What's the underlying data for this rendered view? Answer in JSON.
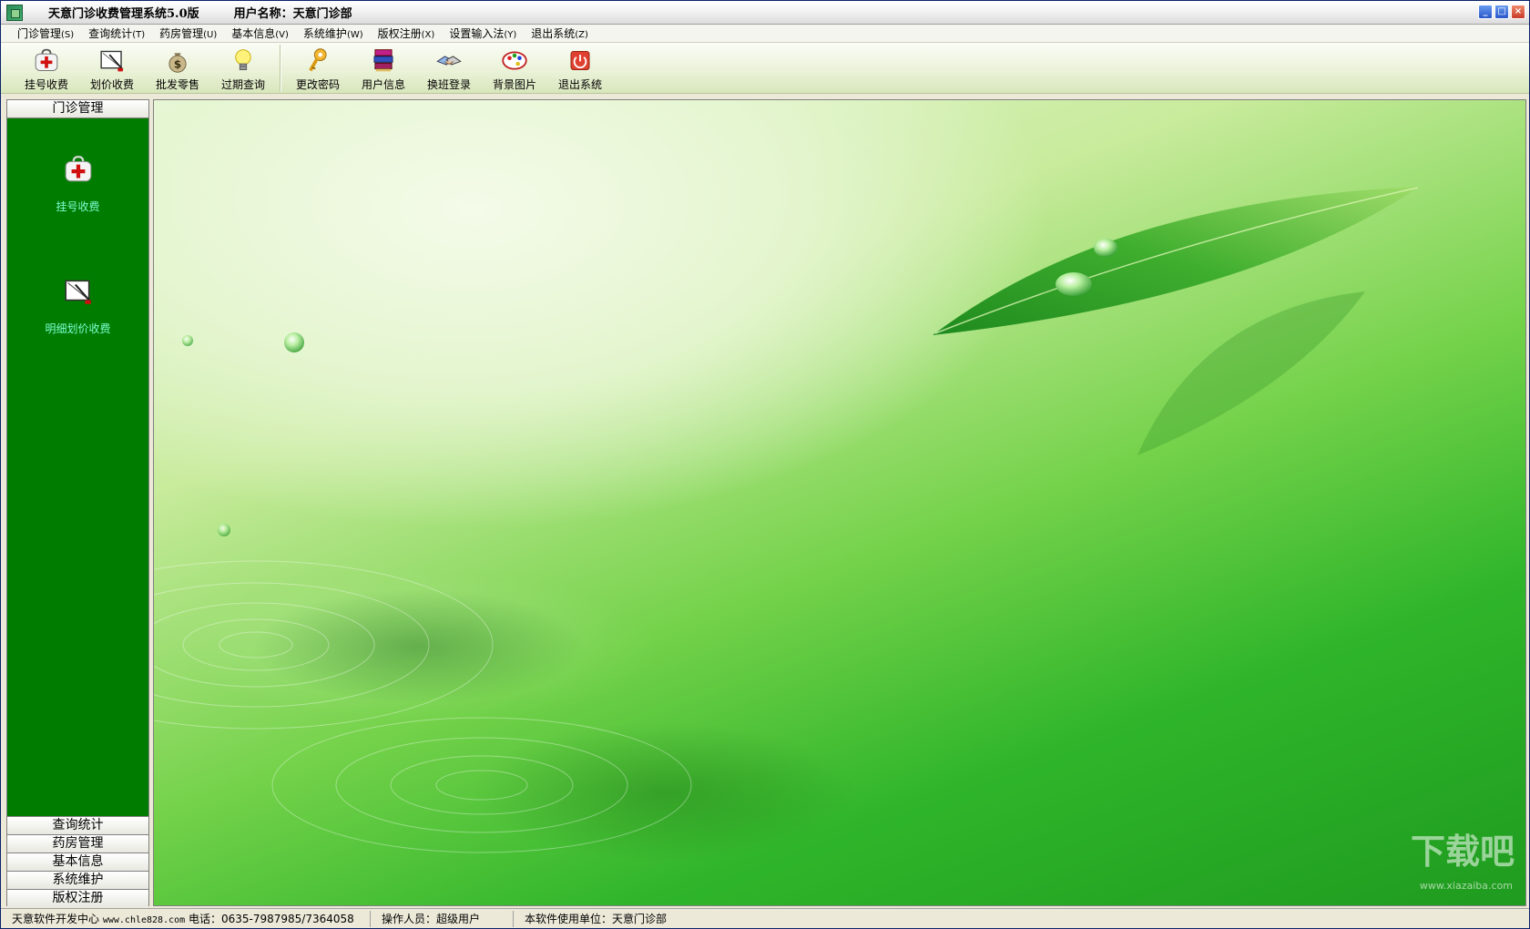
{
  "window": {
    "title": "天意门诊收费管理系统5.0版",
    "user": "用户名称：天意门诊部",
    "controls": [
      "_",
      "□",
      "×"
    ]
  },
  "menu": [
    {
      "label": "门诊管理",
      "mnemonic": "(S)"
    },
    {
      "label": "查询统计",
      "mnemonic": "(T)"
    },
    {
      "label": "药房管理",
      "mnemonic": "(U)"
    },
    {
      "label": "基本信息",
      "mnemonic": "(V)"
    },
    {
      "label": "系统维护",
      "mnemonic": "(W)"
    },
    {
      "label": "版权注册",
      "mnemonic": "(X)"
    },
    {
      "label": "设置输入法",
      "mnemonic": "(Y)"
    },
    {
      "label": "退出系统",
      "mnemonic": "(Z)"
    }
  ],
  "toolbar": [
    {
      "label": "挂号收费",
      "icon": "medical-kit-icon"
    },
    {
      "label": "划价收费",
      "icon": "pen-tablet-icon"
    },
    {
      "label": "批发零售",
      "icon": "money-bag-icon"
    },
    {
      "label": "过期查询",
      "icon": "light-bulb-icon"
    },
    {
      "label": "更改密码",
      "icon": "key-icon"
    },
    {
      "label": "用户信息",
      "icon": "books-icon"
    },
    {
      "label": "换班登录",
      "icon": "handshake-icon"
    },
    {
      "label": "背景图片",
      "icon": "palette-icon"
    },
    {
      "label": "退出系统",
      "icon": "power-icon"
    }
  ],
  "sidebar": {
    "header": "门诊管理",
    "items": [
      {
        "label": "挂号收费",
        "icon": "medical-kit-icon"
      },
      {
        "label": "明细划价收费",
        "icon": "pen-tablet-icon"
      }
    ],
    "categories": [
      "查询统计",
      "药房管理",
      "基本信息",
      "系统维护",
      "版权注册"
    ]
  },
  "statusbar": {
    "company": "天意软件开发中心",
    "url": "www.chle828.com",
    "phone": "电话：0635-7987985/7364058",
    "operator": "操作人员：超级用户",
    "unit": "本软件使用单位：天意门诊部"
  },
  "watermark": {
    "text": "下载吧",
    "sub": "www.xiazaiba.com"
  },
  "colors": {
    "sidebar_panel": "#007d00",
    "sidebar_label": "#7fffd4",
    "accent_green": "#2fb52a"
  }
}
